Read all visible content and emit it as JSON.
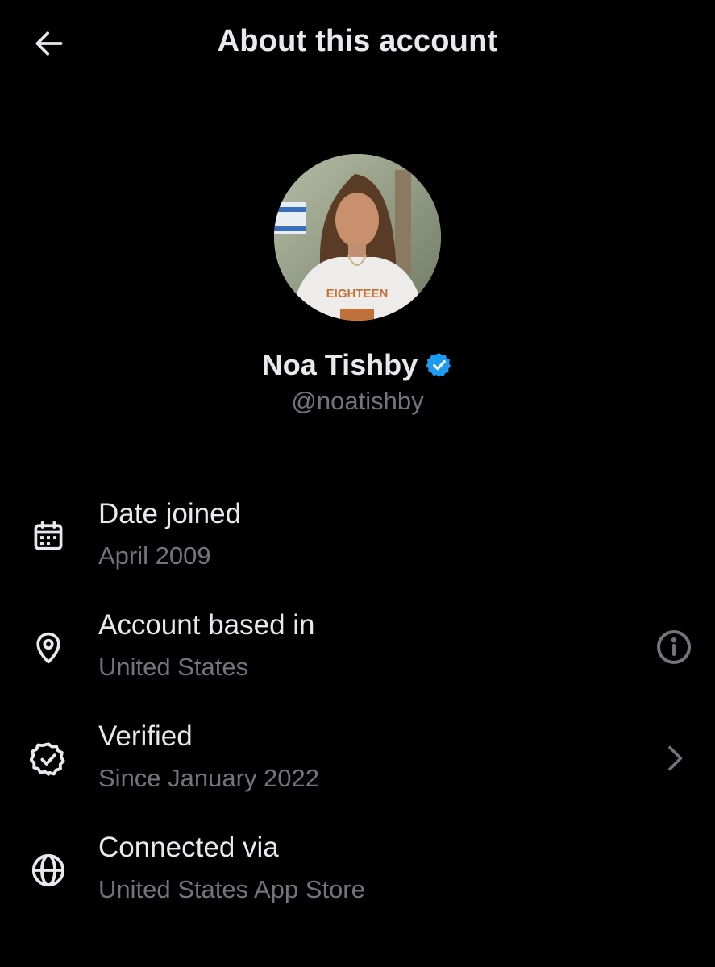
{
  "header": {
    "title": "About this account",
    "back_icon": "arrow-left-icon"
  },
  "profile": {
    "display_name": "Noa Tishby",
    "handle": "@noatishby",
    "verified_badge_color": "#1d9bf0",
    "avatar_shirt_text": "EIGHTEEN"
  },
  "rows": [
    {
      "icon": "calendar-icon",
      "label": "Date joined",
      "value": "April 2009"
    },
    {
      "icon": "location-pin-icon",
      "label": "Account based in",
      "value": "United States",
      "trailing_icon": "info-icon"
    },
    {
      "icon": "verified-badge-icon",
      "label": "Verified",
      "value": "Since January 2022",
      "trailing_icon": "chevron-right-icon"
    },
    {
      "icon": "globe-icon",
      "label": "Connected via",
      "value": "United States App Store"
    }
  ],
  "colors": {
    "background": "#000000",
    "primary_text": "#e7e9ea",
    "secondary_text": "#71767b",
    "accent": "#1d9bf0"
  }
}
